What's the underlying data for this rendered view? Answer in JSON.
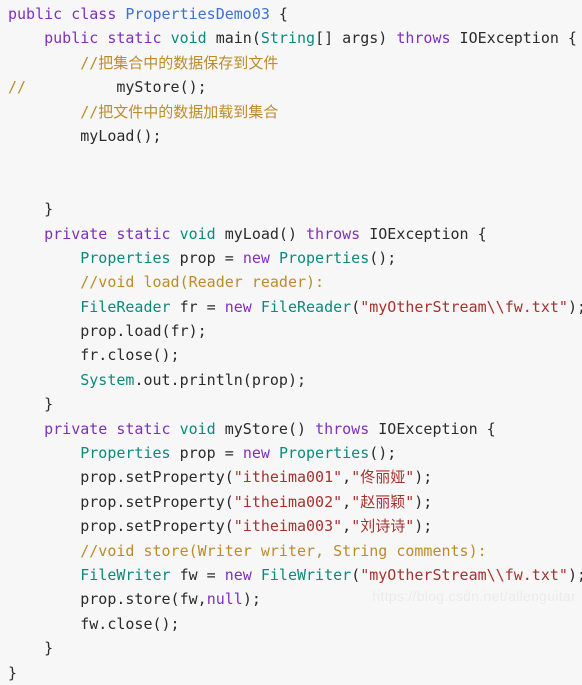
{
  "editor": {
    "background_color": "#f7f7f7",
    "font_size_px": 15,
    "line_height_px": 24.4,
    "language": "java",
    "file_title": "PropertiesDemo03"
  },
  "colors": {
    "keyword": "#7f2fbf",
    "type": "#0b8a7d",
    "class_name": "#3f6fd8",
    "plain": "#2b2b2b",
    "comment": "#bd8b2a",
    "string": "#a8312f",
    "watermark": "#ebebeb"
  },
  "watermark": {
    "text": "https://blog.csdn.net/allenguitar"
  },
  "code": {
    "lines": [
      {
        "tokens": [
          {
            "t": "public",
            "c": "kw"
          },
          {
            "t": " ",
            "c": "plain"
          },
          {
            "t": "class",
            "c": "kw"
          },
          {
            "t": " ",
            "c": "plain"
          },
          {
            "t": "PropertiesDemo03",
            "c": "cls"
          },
          {
            "t": " {",
            "c": "plain"
          }
        ]
      },
      {
        "tokens": [
          {
            "t": "    ",
            "c": "plain"
          },
          {
            "t": "public",
            "c": "kw"
          },
          {
            "t": " ",
            "c": "plain"
          },
          {
            "t": "static",
            "c": "kw"
          },
          {
            "t": " ",
            "c": "plain"
          },
          {
            "t": "void",
            "c": "type"
          },
          {
            "t": " main(",
            "c": "plain"
          },
          {
            "t": "String",
            "c": "type"
          },
          {
            "t": "[] args) ",
            "c": "plain"
          },
          {
            "t": "throws",
            "c": "kw"
          },
          {
            "t": " IOException {",
            "c": "plain"
          }
        ]
      },
      {
        "tokens": [
          {
            "t": "        ",
            "c": "plain"
          },
          {
            "t": "//把集合中的数据保存到文件",
            "c": "com"
          }
        ]
      },
      {
        "tokens": [
          {
            "t": "//",
            "c": "com"
          },
          {
            "t": "          myStore();",
            "c": "plain"
          }
        ]
      },
      {
        "tokens": [
          {
            "t": "        ",
            "c": "plain"
          },
          {
            "t": "//把文件中的数据加载到集合",
            "c": "com"
          }
        ]
      },
      {
        "tokens": [
          {
            "t": "        myLoad();",
            "c": "plain"
          }
        ]
      },
      {
        "tokens": []
      },
      {
        "tokens": []
      },
      {
        "tokens": [
          {
            "t": "    }",
            "c": "plain"
          }
        ]
      },
      {
        "tokens": [
          {
            "t": "    ",
            "c": "plain"
          },
          {
            "t": "private",
            "c": "kw"
          },
          {
            "t": " ",
            "c": "plain"
          },
          {
            "t": "static",
            "c": "kw"
          },
          {
            "t": " ",
            "c": "plain"
          },
          {
            "t": "void",
            "c": "type"
          },
          {
            "t": " myLoad() ",
            "c": "plain"
          },
          {
            "t": "throws",
            "c": "kw"
          },
          {
            "t": " IOException {",
            "c": "plain"
          }
        ]
      },
      {
        "tokens": [
          {
            "t": "        ",
            "c": "plain"
          },
          {
            "t": "Properties",
            "c": "type"
          },
          {
            "t": " prop = ",
            "c": "plain"
          },
          {
            "t": "new",
            "c": "kw"
          },
          {
            "t": " ",
            "c": "plain"
          },
          {
            "t": "Properties",
            "c": "type"
          },
          {
            "t": "();",
            "c": "plain"
          }
        ]
      },
      {
        "tokens": [
          {
            "t": "        ",
            "c": "plain"
          },
          {
            "t": "//void load(Reader reader):",
            "c": "com"
          }
        ]
      },
      {
        "tokens": [
          {
            "t": "        ",
            "c": "plain"
          },
          {
            "t": "FileReader",
            "c": "type"
          },
          {
            "t": " fr = ",
            "c": "plain"
          },
          {
            "t": "new",
            "c": "kw"
          },
          {
            "t": " ",
            "c": "plain"
          },
          {
            "t": "FileReader",
            "c": "type"
          },
          {
            "t": "(",
            "c": "plain"
          },
          {
            "t": "\"myOtherStream\\\\fw.txt\"",
            "c": "str"
          },
          {
            "t": ");",
            "c": "plain"
          }
        ]
      },
      {
        "tokens": [
          {
            "t": "        prop.load(fr);",
            "c": "plain"
          }
        ]
      },
      {
        "tokens": [
          {
            "t": "        fr.close();",
            "c": "plain"
          }
        ]
      },
      {
        "tokens": [
          {
            "t": "        ",
            "c": "plain"
          },
          {
            "t": "System",
            "c": "type"
          },
          {
            "t": ".out.println(prop);",
            "c": "plain"
          }
        ]
      },
      {
        "tokens": [
          {
            "t": "    }",
            "c": "plain"
          }
        ]
      },
      {
        "tokens": [
          {
            "t": "    ",
            "c": "plain"
          },
          {
            "t": "private",
            "c": "kw"
          },
          {
            "t": " ",
            "c": "plain"
          },
          {
            "t": "static",
            "c": "kw"
          },
          {
            "t": " ",
            "c": "plain"
          },
          {
            "t": "void",
            "c": "type"
          },
          {
            "t": " myStore() ",
            "c": "plain"
          },
          {
            "t": "throws",
            "c": "kw"
          },
          {
            "t": " IOException {",
            "c": "plain"
          }
        ]
      },
      {
        "tokens": [
          {
            "t": "        ",
            "c": "plain"
          },
          {
            "t": "Properties",
            "c": "type"
          },
          {
            "t": " prop = ",
            "c": "plain"
          },
          {
            "t": "new",
            "c": "kw"
          },
          {
            "t": " ",
            "c": "plain"
          },
          {
            "t": "Properties",
            "c": "type"
          },
          {
            "t": "();",
            "c": "plain"
          }
        ]
      },
      {
        "tokens": [
          {
            "t": "        prop.setProperty(",
            "c": "plain"
          },
          {
            "t": "\"itheima001\"",
            "c": "str"
          },
          {
            "t": ",",
            "c": "plain"
          },
          {
            "t": "\"佟丽娅\"",
            "c": "str"
          },
          {
            "t": ");",
            "c": "plain"
          }
        ]
      },
      {
        "tokens": [
          {
            "t": "        prop.setProperty(",
            "c": "plain"
          },
          {
            "t": "\"itheima002\"",
            "c": "str"
          },
          {
            "t": ",",
            "c": "plain"
          },
          {
            "t": "\"赵丽颖\"",
            "c": "str"
          },
          {
            "t": ");",
            "c": "plain"
          }
        ]
      },
      {
        "tokens": [
          {
            "t": "        prop.setProperty(",
            "c": "plain"
          },
          {
            "t": "\"itheima003\"",
            "c": "str"
          },
          {
            "t": ",",
            "c": "plain"
          },
          {
            "t": "\"刘诗诗\"",
            "c": "str"
          },
          {
            "t": ");",
            "c": "plain"
          }
        ]
      },
      {
        "tokens": [
          {
            "t": "        ",
            "c": "plain"
          },
          {
            "t": "//void store(Writer writer, String comments):",
            "c": "com"
          }
        ]
      },
      {
        "tokens": [
          {
            "t": "        ",
            "c": "plain"
          },
          {
            "t": "FileWriter",
            "c": "type"
          },
          {
            "t": " fw = ",
            "c": "plain"
          },
          {
            "t": "new",
            "c": "kw"
          },
          {
            "t": " ",
            "c": "plain"
          },
          {
            "t": "FileWriter",
            "c": "type"
          },
          {
            "t": "(",
            "c": "plain"
          },
          {
            "t": "\"myOtherStream\\\\fw.txt\"",
            "c": "str"
          },
          {
            "t": ");",
            "c": "plain"
          }
        ]
      },
      {
        "tokens": [
          {
            "t": "        prop.store(fw,",
            "c": "plain"
          },
          {
            "t": "null",
            "c": "null"
          },
          {
            "t": ");",
            "c": "plain"
          }
        ]
      },
      {
        "tokens": [
          {
            "t": "        fw.close();",
            "c": "plain"
          }
        ]
      },
      {
        "tokens": [
          {
            "t": "    }",
            "c": "plain"
          }
        ]
      },
      {
        "tokens": [
          {
            "t": "}",
            "c": "plain"
          }
        ]
      }
    ]
  }
}
